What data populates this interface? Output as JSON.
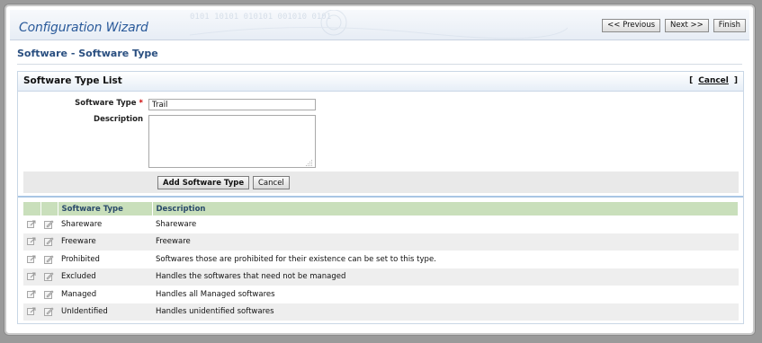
{
  "wizard": {
    "title": "Configuration Wizard",
    "previous_label": "<< Previous",
    "next_label": "Next >>",
    "finish_label": "Finish",
    "banner_text": "0101 10101 010101 001010 0101"
  },
  "section": {
    "title": "Software - Software Type"
  },
  "panel": {
    "title": "Software Type List",
    "cancel_open": "[",
    "cancel_label": "Cancel",
    "cancel_close": "]"
  },
  "form": {
    "type_label": "Software Type",
    "required_mark": "*",
    "type_value": "Trail",
    "description_label": "Description",
    "description_value": "",
    "add_label": "Add Software Type",
    "cancel_label": "Cancel"
  },
  "table": {
    "columns": [
      "",
      "",
      "Software Type",
      "Description"
    ],
    "rows": [
      {
        "type": "Shareware",
        "description": "Shareware"
      },
      {
        "type": "Freeware",
        "description": "Freeware"
      },
      {
        "type": "Prohibited",
        "description": "Softwares those are prohibited for their existence can be set to this type."
      },
      {
        "type": "Excluded",
        "description": "Handles the softwares that need not be managed"
      },
      {
        "type": "Managed",
        "description": "Handles all Managed softwares"
      },
      {
        "type": "UnIdentified",
        "description": "Handles unidentified softwares"
      }
    ],
    "row_icons": [
      "move-icon",
      "edit-icon"
    ]
  },
  "colors": {
    "title_blue": "#2a5a9a",
    "section_blue": "#2a4f80",
    "header_green": "#c9dfbb",
    "required_red": "#cc0000"
  }
}
